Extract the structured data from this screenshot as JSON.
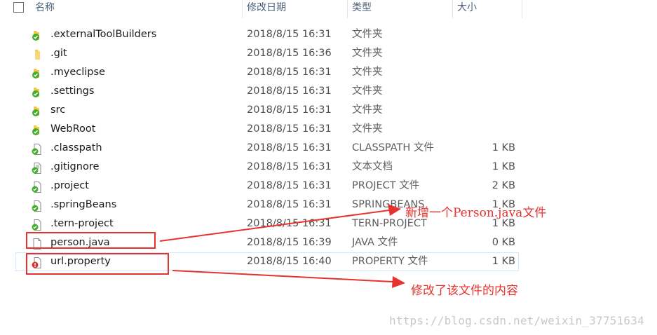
{
  "header": {
    "name": "名称",
    "date": "修改日期",
    "type": "类型",
    "size": "大小"
  },
  "rows": [
    {
      "name": ".externalToolBuilders",
      "date": "2018/8/15 16:31",
      "type": "文件夹",
      "size": "",
      "icon": "folder-synced-icon"
    },
    {
      "name": ".git",
      "date": "2018/8/15 16:36",
      "type": "文件夹",
      "size": "",
      "icon": "folder-icon"
    },
    {
      "name": ".myeclipse",
      "date": "2018/8/15 16:31",
      "type": "文件夹",
      "size": "",
      "icon": "folder-synced-icon"
    },
    {
      "name": ".settings",
      "date": "2018/8/15 16:31",
      "type": "文件夹",
      "size": "",
      "icon": "folder-synced-icon"
    },
    {
      "name": "src",
      "date": "2018/8/15 16:31",
      "type": "文件夹",
      "size": "",
      "icon": "folder-synced-icon"
    },
    {
      "name": "WebRoot",
      "date": "2018/8/15 16:31",
      "type": "文件夹",
      "size": "",
      "icon": "folder-synced-icon"
    },
    {
      "name": ".classpath",
      "date": "2018/8/15 16:31",
      "type": "CLASSPATH 文件",
      "size": "1 KB",
      "icon": "file-synced-icon"
    },
    {
      "name": ".gitignore",
      "date": "2018/8/15 16:31",
      "type": "文本文档",
      "size": "1 KB",
      "icon": "text-file-synced-icon"
    },
    {
      "name": ".project",
      "date": "2018/8/15 16:31",
      "type": "PROJECT 文件",
      "size": "2 KB",
      "icon": "file-synced-icon"
    },
    {
      "name": ".springBeans",
      "date": "2018/8/15 16:31",
      "type": "SPRINGBEANS",
      "size": "1 KB",
      "icon": "file-synced-icon"
    },
    {
      "name": ".tern-project",
      "date": "2018/8/15 16:31",
      "type": "TERN-PROJECT",
      "size": "1 KB",
      "icon": "file-synced-icon"
    },
    {
      "name": "person.java",
      "date": "2018/8/15 16:39",
      "type": "JAVA 文件",
      "size": "0 KB",
      "icon": "file-icon"
    },
    {
      "name": "url.property",
      "date": "2018/8/15 16:40",
      "type": "PROPERTY 文件",
      "size": "1 KB",
      "icon": "file-modified-icon"
    }
  ],
  "annotations": {
    "new_file": "新增一个Person.java文件",
    "modified_file": "修改了该文件的内容",
    "color": "#e8322f"
  },
  "watermark": "https://blog.csdn.net/weixin_37751634",
  "colors": {
    "synced": "#3fae2a",
    "modified": "#d9342b",
    "folder": "#f2c94c",
    "header_text": "#4c607a"
  }
}
